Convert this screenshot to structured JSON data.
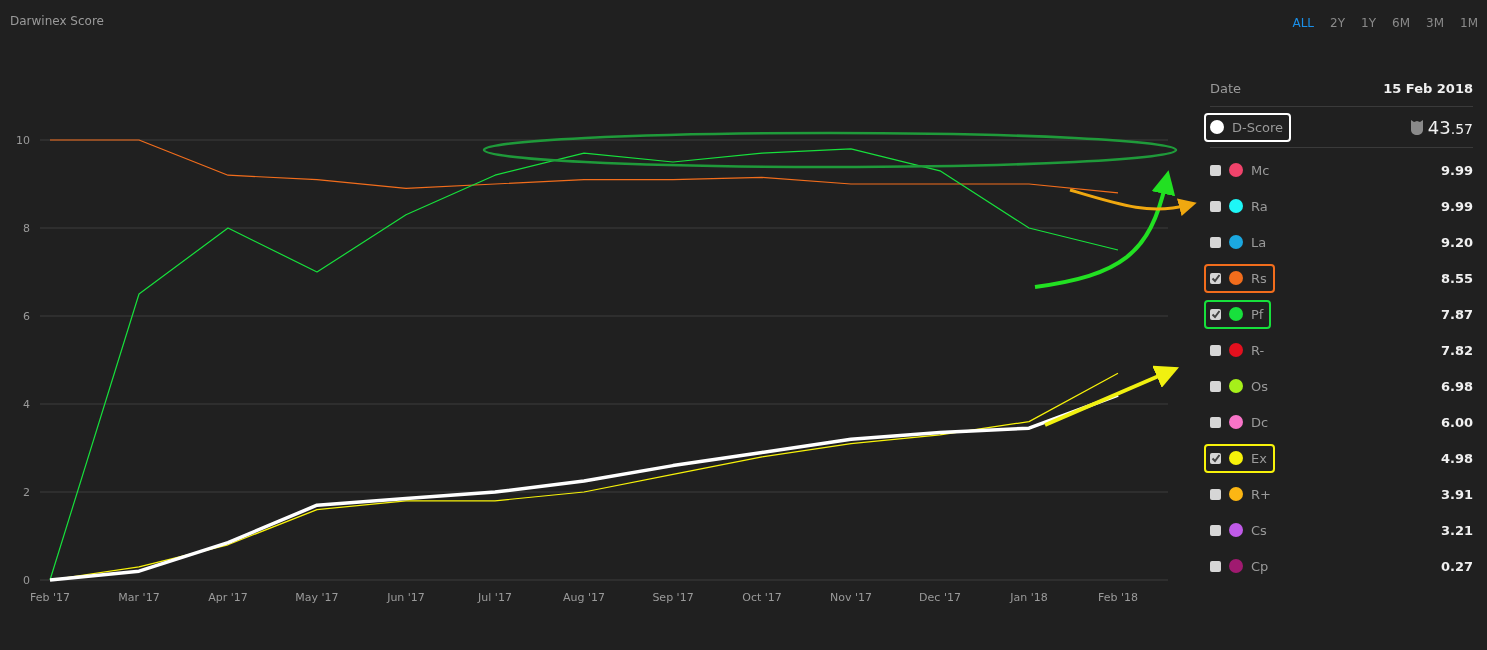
{
  "title": "Darwinex Score",
  "ranges": [
    {
      "label": "ALL",
      "selected": true
    },
    {
      "label": "2Y",
      "selected": false
    },
    {
      "label": "1Y",
      "selected": false
    },
    {
      "label": "6M",
      "selected": false
    },
    {
      "label": "3M",
      "selected": false
    },
    {
      "label": "1M",
      "selected": false
    }
  ],
  "date": {
    "label": "Date",
    "value": "15 Feb 2018"
  },
  "dscore": {
    "label": "D-Score",
    "color": "#ffffff",
    "value_main": "43",
    "value_fraction": ".57",
    "highlighted": true
  },
  "legend": [
    {
      "label": "Mc",
      "color": "#f0436b",
      "value": "9.99",
      "checked": false,
      "highlighted": false
    },
    {
      "label": "Ra",
      "color": "#1ef6f6",
      "value": "9.99",
      "checked": false,
      "highlighted": false
    },
    {
      "label": "La",
      "color": "#1ba8e0",
      "value": "9.20",
      "checked": false,
      "highlighted": false
    },
    {
      "label": "Rs",
      "color": "#f26d1c",
      "value": "8.55",
      "checked": true,
      "highlighted": true
    },
    {
      "label": "Pf",
      "color": "#17e03c",
      "value": "7.87",
      "checked": true,
      "highlighted": true
    },
    {
      "label": "R-",
      "color": "#e3101e",
      "value": "7.82",
      "checked": false,
      "highlighted": false
    },
    {
      "label": "Os",
      "color": "#a6f01a",
      "value": "6.98",
      "checked": false,
      "highlighted": false
    },
    {
      "label": "Dc",
      "color": "#f874c8",
      "value": "6.00",
      "checked": false,
      "highlighted": false
    },
    {
      "label": "Ex",
      "color": "#f7f20a",
      "value": "4.98",
      "checked": true,
      "highlighted": true
    },
    {
      "label": "R+",
      "color": "#fcb613",
      "value": "3.91",
      "checked": false,
      "highlighted": false
    },
    {
      "label": "Cs",
      "color": "#c05ae8",
      "value": "3.21",
      "checked": false,
      "highlighted": false
    },
    {
      "label": "Cp",
      "color": "#a01a70",
      "value": "0.27",
      "checked": false,
      "highlighted": false
    }
  ],
  "chart_data": {
    "type": "line",
    "grid": true,
    "categories": [
      "Feb '17",
      "Mar '17",
      "Apr '17",
      "May '17",
      "Jun '17",
      "Jul '17",
      "Aug '17",
      "Sep '17",
      "Oct '17",
      "Nov '17",
      "Dec '17",
      "Jan '18",
      "Feb '18"
    ],
    "yticks": [
      0,
      2,
      4,
      6,
      8,
      10
    ],
    "ylim": [
      0,
      10
    ],
    "series": [
      {
        "color": "#f26d1c",
        "values": [
          10,
          10,
          9.2,
          9.1,
          8.9,
          9.0,
          9.1,
          9.1,
          9.15,
          9.0,
          9.0,
          9.0,
          8.8
        ]
      },
      {
        "color": "#17e03c",
        "values": [
          0,
          6.5,
          8.0,
          7.0,
          8.3,
          9.2,
          9.7,
          9.5,
          9.7,
          9.8,
          9.3,
          8.0,
          7.5
        ]
      },
      {
        "color": "#f7f20a",
        "values": [
          0,
          0.3,
          0.8,
          1.6,
          1.8,
          1.8,
          2.0,
          2.4,
          2.8,
          3.1,
          3.3,
          3.6,
          4.7
        ]
      },
      {
        "color": "#ffffff",
        "values": [
          0,
          0.2,
          0.85,
          1.7,
          1.85,
          2.0,
          2.25,
          2.6,
          2.9,
          3.2,
          3.35,
          3.45,
          4.2
        ]
      }
    ]
  }
}
